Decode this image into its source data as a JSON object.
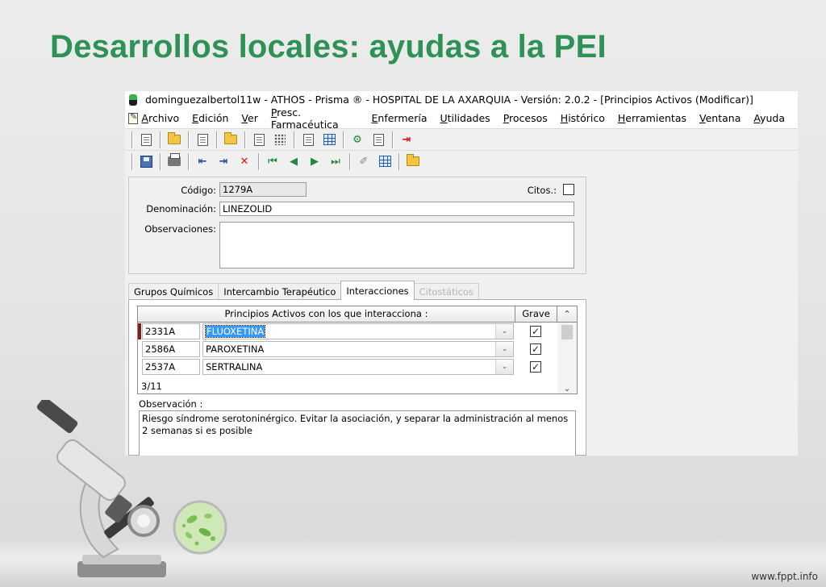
{
  "slide": {
    "title": "Desarrollos locales: ayudas a la PEI",
    "footer": "www.fppt.info",
    "title_color": "#2e9156"
  },
  "window": {
    "title": "dominguezalbertol11w - ATHOS - Prisma ® - HOSPITAL DE LA AXARQUIA - Versión: 2.0.2 - [Principios Activos (Modificar)]"
  },
  "menu": {
    "items": [
      "Archivo",
      "Edición",
      "Ver",
      "Presc. Farmacéutica",
      "Enfermería",
      "Utilidades",
      "Procesos",
      "Histórico",
      "Herramientas",
      "Ventana",
      "Ayuda"
    ]
  },
  "toolbar1": {
    "icons": [
      "edit-doc-icon",
      "open-folder-icon",
      "edit-doc-icon",
      "open-folder-icon",
      "search-doc-icon",
      "list-icon",
      "preview-icon",
      "table-icon",
      "tools-icon",
      "copy-icon",
      "exit-icon"
    ]
  },
  "toolbar2": {
    "icons": [
      "save-icon",
      "print-icon",
      "insert-row-icon",
      "insert-row-icon",
      "delete-row-icon",
      "first-record-icon",
      "previous-record-icon",
      "next-record-icon",
      "last-record-icon",
      "pin-icon",
      "image-icon",
      "folder-icon"
    ]
  },
  "form": {
    "codigo_label": "Código:",
    "codigo_value": "1279A",
    "citos_label": "Citos.:",
    "citos_checked": false,
    "denominacion_label": "Denominación:",
    "denominacion_value": "LINEZOLID",
    "observaciones_label": "Observaciones:",
    "observaciones_value": ""
  },
  "tabs": [
    {
      "label": "Grupos Químicos",
      "state": "normal"
    },
    {
      "label": "Intercambio Terapéutico",
      "state": "normal"
    },
    {
      "label": "Interacciones",
      "state": "active"
    },
    {
      "label": "Citostáticos",
      "state": "disabled"
    }
  ],
  "interactions": {
    "header_main": "Principios Activos con los que interacciona :",
    "header_grave": "Grave",
    "rows": [
      {
        "code": "2331A",
        "name": "FLUOXETINA",
        "grave": true,
        "selected": true
      },
      {
        "code": "2586A",
        "name": "PAROXETINA",
        "grave": true,
        "selected": false
      },
      {
        "code": "2537A",
        "name": "SERTRALINA",
        "grave": true,
        "selected": false
      }
    ],
    "count": "3/11",
    "observation_label": "Observación :",
    "observation_text": "Riesgo síndrome serotoninérgico. Evitar la asociación, y separar la administración al menos 2 semanas si es posible"
  }
}
